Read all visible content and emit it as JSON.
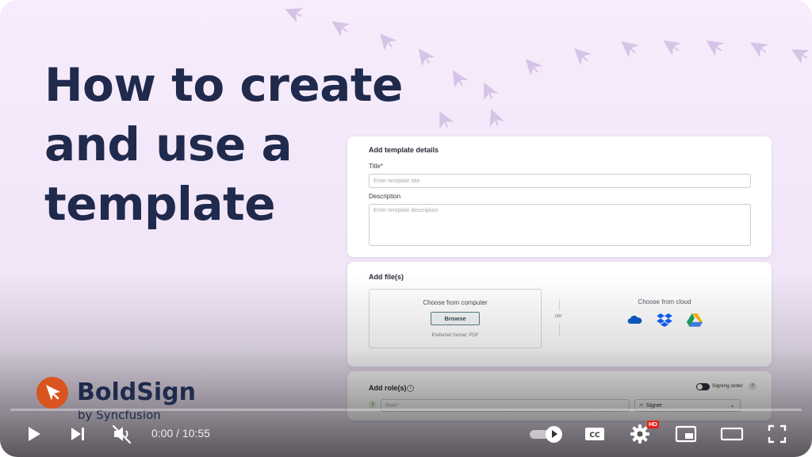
{
  "video": {
    "headline_lines": [
      "How to create",
      "and use a",
      "template"
    ],
    "brand": {
      "name": "BoldSign",
      "subtitle": "by Syncfusion",
      "logo_color": "#d9541e"
    },
    "decoration_icon": "paper-plane-icon"
  },
  "form": {
    "details": {
      "heading": "Add template details",
      "title_label": "Title*",
      "title_placeholder": "Enter template title",
      "description_label": "Description",
      "description_placeholder": "Enter template description"
    },
    "files": {
      "heading": "Add file(s)",
      "computer_label": "Choose from computer",
      "browse_label": "Browse",
      "preferred_format": "Preferred format: PDF",
      "or_label": "OR",
      "cloud_label": "Choose from cloud",
      "cloud_icons": [
        "onedrive-icon",
        "dropbox-icon",
        "google-drive-icon"
      ]
    },
    "roles": {
      "heading": "Add role(s)",
      "info_icon": "i",
      "signing_order_label": "Signing order",
      "help_icon": "?",
      "row_number": "1",
      "role_placeholder": "Role*",
      "role_type": "Signer"
    }
  },
  "player": {
    "current_time": "0:00",
    "duration": "10:55",
    "time_separator": " / ",
    "progress": 0,
    "hd_badge": "HD",
    "autoplay_on": true,
    "muted": true,
    "colors": {
      "hd_badge": "#e62117",
      "controls": "#ffffff"
    }
  },
  "theme": {
    "headline_color": "#1f2a4d",
    "background": "#f3e8f9",
    "plane_color": "#d6c3e6"
  }
}
